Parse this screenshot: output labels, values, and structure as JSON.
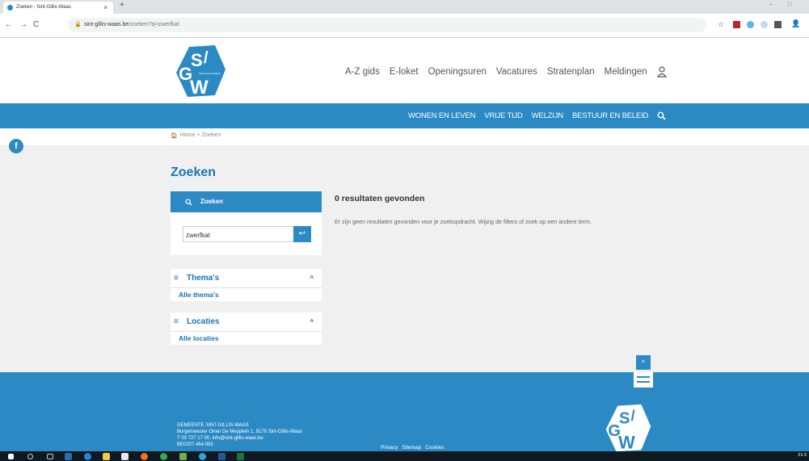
{
  "browser": {
    "tab_title": "Zoeken - Sint-Gillis-Waas",
    "tab_close": "×",
    "new_tab": "+",
    "url_host": "sint-gillis-waas.be",
    "url_path": "/zoeken?q=zwerfkat",
    "back": "←",
    "forward": "→",
    "reload": "C",
    "minimize": "–",
    "restore": "□",
    "bookmark_star": "☆",
    "profile": "👤"
  },
  "logo": {
    "letters_top": "S",
    "letters_left": "G",
    "letters_bottom": "W",
    "tagline": "SINT-GILLIS-WAAS"
  },
  "topnav": [
    "A-Z gids",
    "E-loket",
    "Openingsuren",
    "Vacatures",
    "Stratenplan",
    "Meldingen"
  ],
  "mainnav": [
    "WONEN EN LEVEN",
    "VRIJE TIJD",
    "WELZIJN",
    "BESTUUR EN BELEID"
  ],
  "breadcrumb": {
    "home": "Home",
    "sep": "•",
    "current": "Zoeken"
  },
  "social": {
    "facebook": "f"
  },
  "page_title": "Zoeken",
  "search_panel": {
    "heading": "Zoeken",
    "value": "zwerfkat",
    "submit": "↩"
  },
  "filters": [
    {
      "title": "Thema's",
      "item": "Alle thema's"
    },
    {
      "title": "Locaties",
      "item": "Alle locaties"
    }
  ],
  "results": {
    "title": "0 resultaten gevonden",
    "text": "Er zijn geen resultaten gevonden voor je zoekopdracht. Wijzig de filters of zoek op een andere term."
  },
  "footer": {
    "name": "GEMEENTE SINT-GILLIS-WAAS",
    "address": "Burgemeester Omer De Meyplein 1, 9170 Sint-Gillis-Waas",
    "contact": "T 03 727 17 00, info@sint-gillis-waas.be",
    "vat": "BE0207.464.093",
    "links": [
      "Privacy",
      "Sitemap",
      "Cookies"
    ]
  },
  "taskbar": {
    "clock": "21:3"
  },
  "colors": {
    "brand": "#2b8ac4",
    "heading": "#1a73b5"
  }
}
